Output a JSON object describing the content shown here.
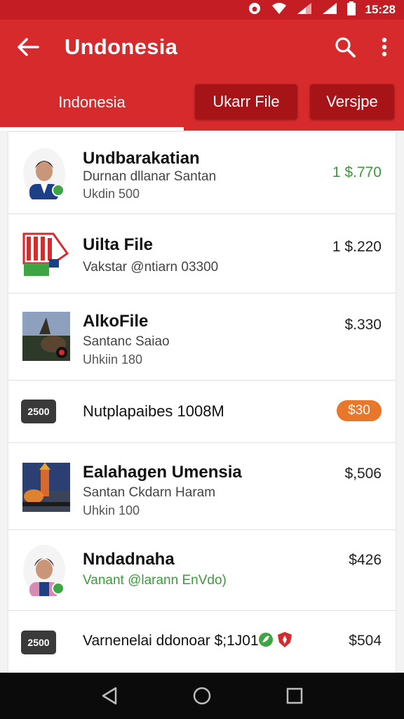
{
  "status_bar": {
    "time": "15:28"
  },
  "app_bar": {
    "title": "Undonesia"
  },
  "tabs": {
    "main": "Indonesia",
    "buttons": [
      "Ukarr File",
      "Versjpe"
    ]
  },
  "colors": {
    "primary": "#d62a2c",
    "primary_dark": "#c41e24",
    "tab_button": "#a61418",
    "green": "#3b9b3b",
    "orange": "#e8762b"
  },
  "items": [
    {
      "name": "Undbarakatian",
      "sub1": "Durnan dllanar Santan",
      "sub2": "Ukdin 500",
      "price": "1 $.770",
      "thumb": "person-avatar"
    },
    {
      "name": "Uilta File",
      "sub1": "Vakstar @ntiarn 03300",
      "price": "1 $.220",
      "thumb": "flag-file-icon"
    },
    {
      "name": "AlkoFile",
      "sub1": "Santanc Saiao",
      "sub2": "Uhkiin 180",
      "price": "$.330",
      "thumb": "photo-thumbnail"
    },
    {
      "badge": "2500",
      "single": "Nutplapaibes 1008M",
      "price": "$30",
      "thumb": "badge"
    },
    {
      "name": "Ealahagen Umensia",
      "sub1": "Santan Ckdarn Haram",
      "sub2": "Uhkin 100",
      "price": "$,506",
      "thumb": "photo-thumbnail"
    },
    {
      "name": "Nndadnaha",
      "sub1": "Vanant @larann EnVdo)",
      "price": "$426",
      "thumb": "person-avatar"
    },
    {
      "badge": "2500",
      "single": "Varnenelai ddonoar $;1J01",
      "price": "$504",
      "thumb": "badge"
    }
  ]
}
